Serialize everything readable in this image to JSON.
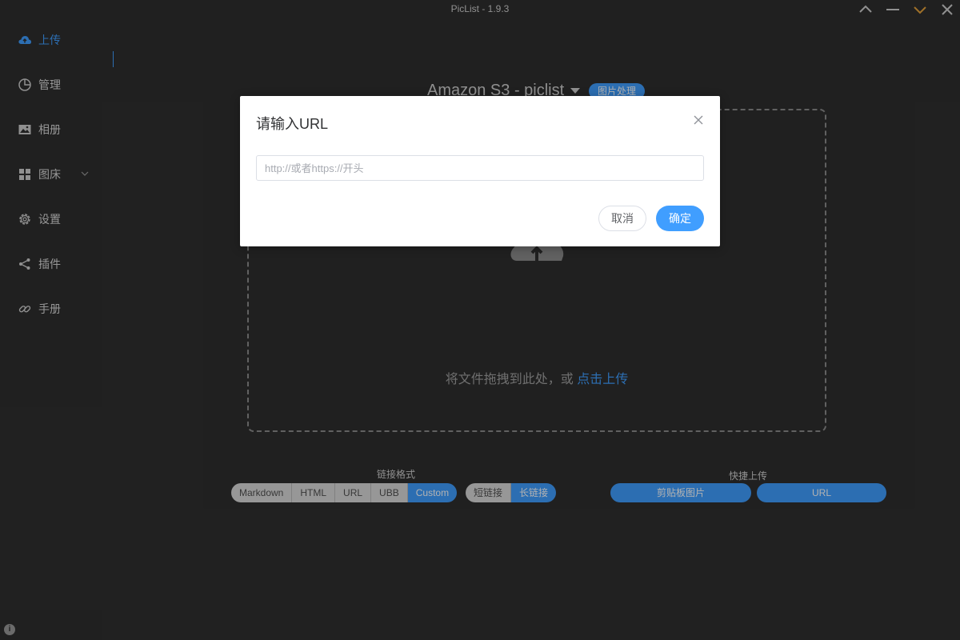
{
  "window": {
    "title": "PicList - 1.9.3"
  },
  "sidebar": {
    "items": [
      {
        "label": "上传",
        "icon": "upload-cloud-icon",
        "active": true
      },
      {
        "label": "管理",
        "icon": "pie-chart-icon"
      },
      {
        "label": "相册",
        "icon": "image-icon"
      },
      {
        "label": "图床",
        "icon": "grid-icon"
      },
      {
        "label": "设置",
        "icon": "gear-icon"
      },
      {
        "label": "插件",
        "icon": "share-icon"
      },
      {
        "label": "手册",
        "icon": "link-icon"
      }
    ]
  },
  "main": {
    "picbed_title": "Amazon S3 - piclist",
    "image_process_label": "图片处理",
    "drop_text": "将文件拖拽到此处，或",
    "drop_link": "点击上传"
  },
  "link_format": {
    "label": "链接格式",
    "formats": [
      "Markdown",
      "HTML",
      "URL",
      "UBB",
      "Custom"
    ],
    "selected": "Custom",
    "length_options": [
      "短链接",
      "长链接"
    ],
    "length_selected": "长链接"
  },
  "quick_upload": {
    "label": "快捷上传",
    "clipboard_label": "剪贴板图片",
    "url_label": "URL"
  },
  "dialog": {
    "title": "请输入URL",
    "input_value": "",
    "input_placeholder": "http://或者https://开头",
    "cancel_label": "取消",
    "confirm_label": "确定"
  },
  "colors": {
    "accent": "#409eff",
    "background": "#2f2f2f",
    "minimize_to_tray": "#e6a23c"
  }
}
